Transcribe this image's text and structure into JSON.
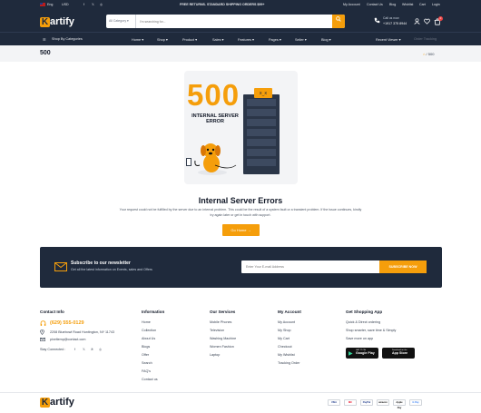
{
  "topbar": {
    "language": "Eng",
    "currency": "USD",
    "promo": "FREE RETURNS. STANDARD SHIPPING ORDERS $99+",
    "links": [
      "My Account",
      "Contact Us",
      "Blog",
      "Wishlist",
      "Cart",
      "Login"
    ]
  },
  "header": {
    "logo": "artify",
    "search_category": "All Category",
    "search_placeholder": "I'm searching for...",
    "call_label": "Call us now",
    "phone": "+1917 375 8944",
    "cart_count": "0"
  },
  "nav": {
    "shop_by_categories": "Shop By Categories",
    "items": [
      "Home",
      "Shop",
      "Product",
      "Sales",
      "Features",
      "Pages",
      "Seller",
      "Blog"
    ],
    "recent_viewer": "Recent Viewer",
    "order_tracking": "Order Tracking"
  },
  "breadcrumb": {
    "title": "500",
    "current": "500"
  },
  "error": {
    "code": "500",
    "art_line1": "INTERNAL SERVER",
    "art_line2": "ERROR",
    "title": "Internal Server Errors",
    "message": "Your request could not be fulfilled by the server due to an internal problem. This could be the result of a system fault or a transient problem. If the issue continues, kindly try again later or get in touch with support.",
    "button": "Go Home →"
  },
  "newsletter": {
    "title": "Subscribe to our newsletter",
    "subtitle": "Get all the latest information on Events, sales and Offers",
    "placeholder": "Enter Your E-mail Address",
    "button": "SUBSCRIBE NOW"
  },
  "footer": {
    "contact": {
      "title": "Contact Info",
      "phone": "(629) 555-0129",
      "address": "2208 Bluebowl Road Huntington, NY 11743",
      "email": "pixeltemp@contact.com",
      "stay_connected": "Stay Connected :"
    },
    "information": {
      "title": "Information",
      "links": [
        "Home",
        "Collection",
        "About Us",
        "Blogs",
        "Offer",
        "Search",
        "FAQ's",
        "Contact us"
      ]
    },
    "services": {
      "title": "Our Services",
      "links": [
        "Mobile Phones",
        "Television",
        "Washing Machine",
        "Women Fashion",
        "Laptop"
      ]
    },
    "account": {
      "title": "My Account",
      "links": [
        "My Account",
        "My Shop",
        "My Cart",
        "Checkout",
        "My Wishlist",
        "Tracking Order"
      ]
    },
    "app": {
      "title": "Get Shopping App",
      "links": [
        "Quick & Direct ordering",
        "Shop smarter, save time & Simply",
        "Save more on app"
      ],
      "google_play_small": "GET IT ON",
      "google_play": "Google Play",
      "app_store_small": "Download on the",
      "app_store": "App Store"
    },
    "payments": [
      "VISA",
      "MC",
      "PayPal",
      "amazon",
      "Apple Pay",
      "G Pay"
    ]
  },
  "colors": {
    "accent": "#f59e0b",
    "dark": "#1f2a3c"
  }
}
